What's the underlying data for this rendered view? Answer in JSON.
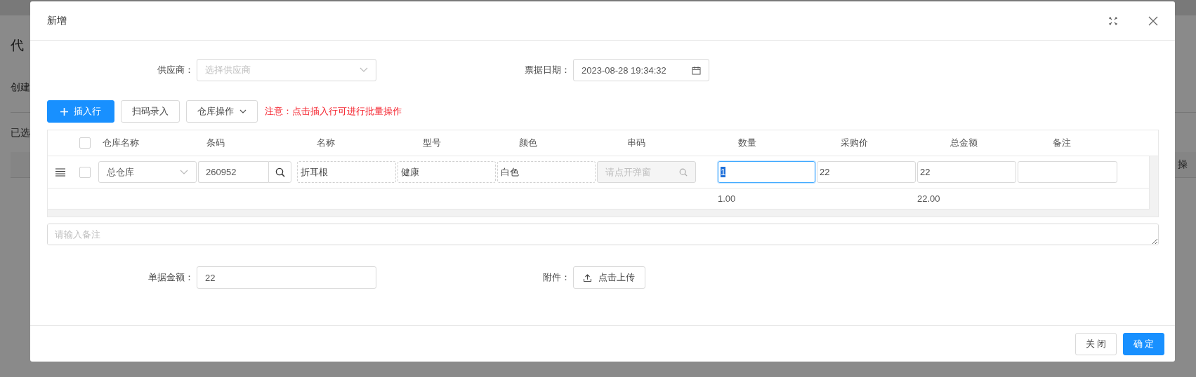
{
  "background": {
    "title": "代",
    "label_1": "创建",
    "label_2": "已选",
    "column_header": "操"
  },
  "dialog": {
    "title": "新增"
  },
  "form": {
    "supplier": {
      "label": "供应商：",
      "placeholder": "选择供应商"
    },
    "date": {
      "label": "票据日期：",
      "value": "2023-08-28 19:34:32"
    }
  },
  "toolbar": {
    "buttons": [
      {
        "label": "插入行",
        "kind": "primary"
      },
      {
        "label": "扫码录入",
        "kind": "default"
      },
      {
        "label": "仓库操作",
        "kind": "dropdown"
      }
    ],
    "notice": "注意：点击插入行可进行批量操作"
  },
  "table": {
    "header_checked": false,
    "columns": [
      "仓库名称",
      "条码",
      "名称",
      "型号",
      "颜色",
      "串码",
      "数量",
      "采购价",
      "总金额",
      "备注"
    ],
    "rows": [
      {
        "checked": false,
        "warehouse": "总仓库",
        "barcode": "260952",
        "name": "折耳根",
        "model": "健康",
        "shade": "白色",
        "serial_placeholder": "请点开弹窗",
        "quantity": "1",
        "quantity_focused": true,
        "price": "22",
        "total": "22"
      }
    ],
    "summary": {
      "quantity": "1.00",
      "total": "22.00"
    }
  },
  "remark": {
    "placeholder": "请输入备注"
  },
  "bill_amount": {
    "label": "单据金额：",
    "value": "22"
  },
  "attachment": {
    "label": "附件：",
    "button": "点击上传"
  },
  "footer": {
    "buttons": [
      {
        "label": "关 闭",
        "kind": "default"
      },
      {
        "label": "确 定",
        "kind": "primary"
      }
    ]
  }
}
